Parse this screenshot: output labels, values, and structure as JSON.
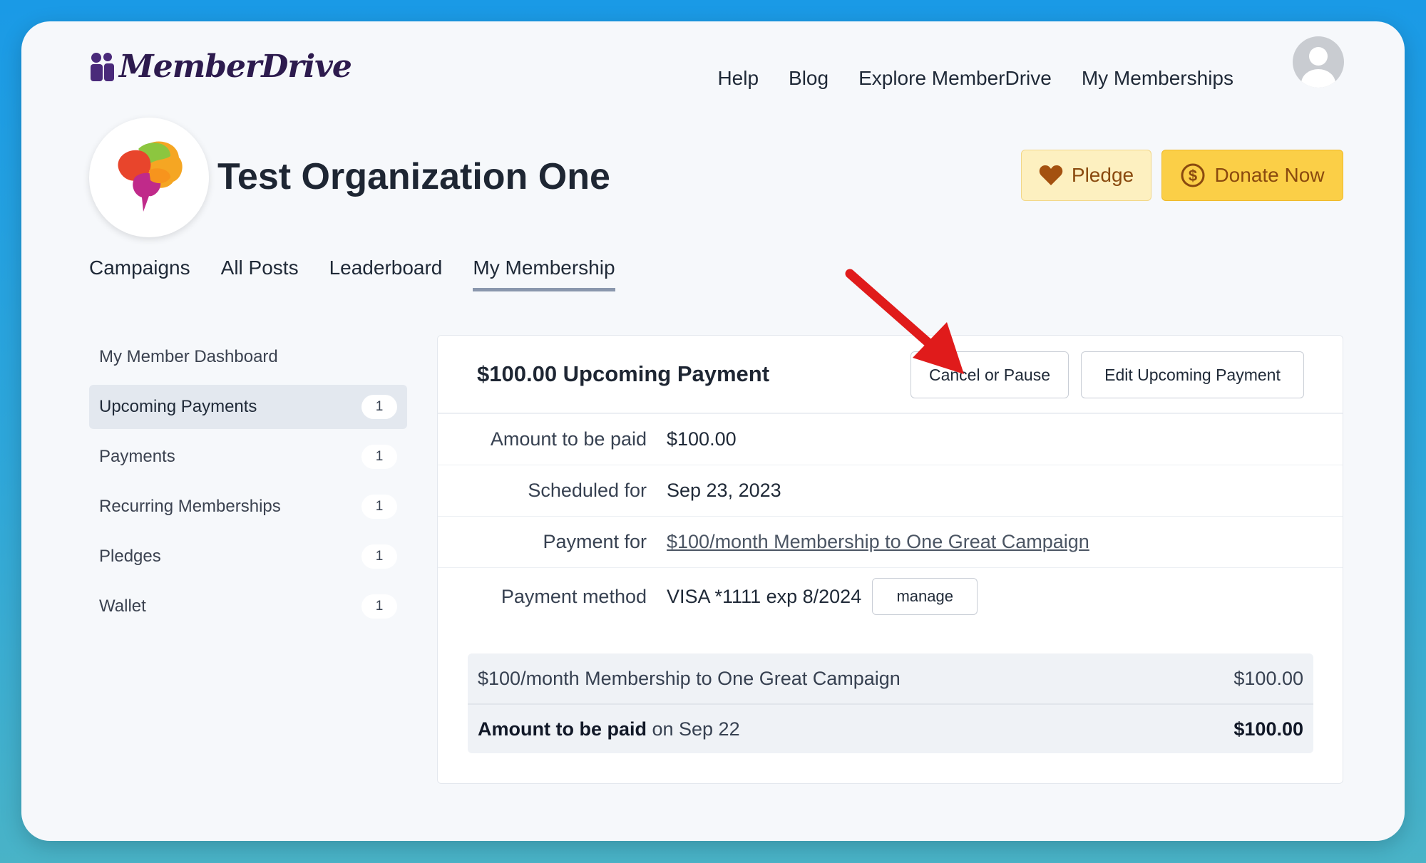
{
  "app": {
    "logo_text": "MemberDrive"
  },
  "topnav": {
    "items": [
      "Help",
      "Blog",
      "Explore MemberDrive",
      "My Memberships"
    ]
  },
  "org": {
    "name": "Test Organization One",
    "pledge_label": "Pledge",
    "donate_label": "Donate Now"
  },
  "tabs": [
    {
      "label": "Campaigns"
    },
    {
      "label": "All Posts"
    },
    {
      "label": "Leaderboard"
    },
    {
      "label": "My Membership",
      "active": true
    }
  ],
  "sidebar": {
    "items": [
      {
        "label": "My Member Dashboard",
        "count": ""
      },
      {
        "label": "Upcoming Payments",
        "count": "1",
        "active": true
      },
      {
        "label": "Payments",
        "count": "1"
      },
      {
        "label": "Recurring Memberships",
        "count": "1"
      },
      {
        "label": "Pledges",
        "count": "1"
      },
      {
        "label": "Wallet",
        "count": "1"
      }
    ]
  },
  "payment": {
    "title": "$100.00 Upcoming Payment",
    "cancel_label": "Cancel or Pause",
    "edit_label": "Edit Upcoming Payment",
    "rows": {
      "amount_label": "Amount to be paid",
      "amount_value": "$100.00",
      "scheduled_label": "Scheduled for",
      "scheduled_value": "Sep 23, 2023",
      "for_label": "Payment for",
      "for_value": "$100/month Membership to One Great Campaign",
      "method_label": "Payment method",
      "method_value": "VISA *1111 exp 8/2024",
      "manage_label": "manage"
    },
    "summary": {
      "item_label": "$100/month Membership to One Great Campaign",
      "item_amount": "$100.00",
      "total_label_bold": "Amount to be paid",
      "total_label_rest": " on Sep 22",
      "total_amount": "$100.00"
    }
  },
  "colors": {
    "accent": "#fbcf47",
    "arrow": "#e01b1b",
    "tab_underline": "#8a97ad"
  }
}
